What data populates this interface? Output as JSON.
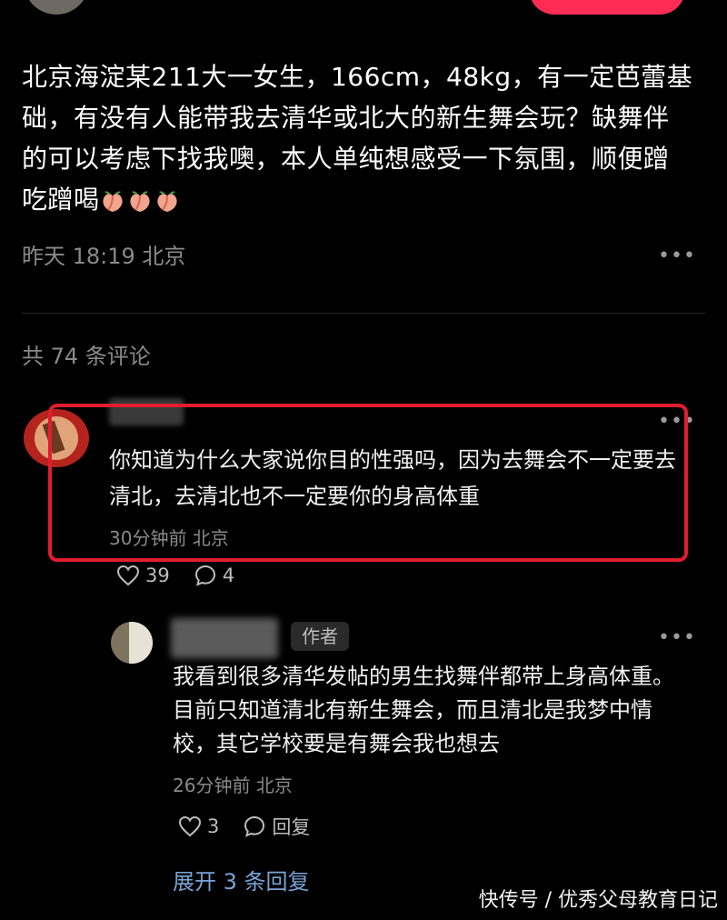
{
  "post": {
    "text": "北京海淀某211大一女生，166cm，48kg，有一定芭蕾基础，有没有人能带我去清华或北大的新生舞会玩？缺舞伴的可以考虑下找我噢，本人单纯想感受一下氛围，顺便蹭吃蹭喝",
    "emojis": [
      "peach-emoji",
      "peach-emoji",
      "peach-emoji"
    ],
    "meta": "昨天 18:19 北京",
    "more_icon": "more-icon"
  },
  "comments_header": {
    "count_text": "共 74 条评论"
  },
  "comment": {
    "text": "你知道为什么大家说你目的性强吗，因为去舞会不一定要去清北，去清北也不一定要你的身高体重",
    "meta": "30分钟前 北京",
    "likes": "39",
    "replies": "4",
    "highlight_color": "#e11d2f"
  },
  "reply": {
    "badge": "作者",
    "text": "我看到很多清华发帖的男生找舞伴都带上身高体重。目前只知道清北有新生舞会，而且清北是我梦中情校，其它学校要是有舞会我也想去",
    "meta": "26分钟前 北京",
    "likes": "3",
    "reply_label": "回复"
  },
  "expand": {
    "label": "展开 3 条回复"
  },
  "watermark": {
    "text": "快传号 / 优秀父母教育日记"
  },
  "colors": {
    "background": "#000000",
    "accent_red": "#fe2c55",
    "link_blue": "#7aa3d6",
    "meta_gray": "#8a8a8a"
  }
}
